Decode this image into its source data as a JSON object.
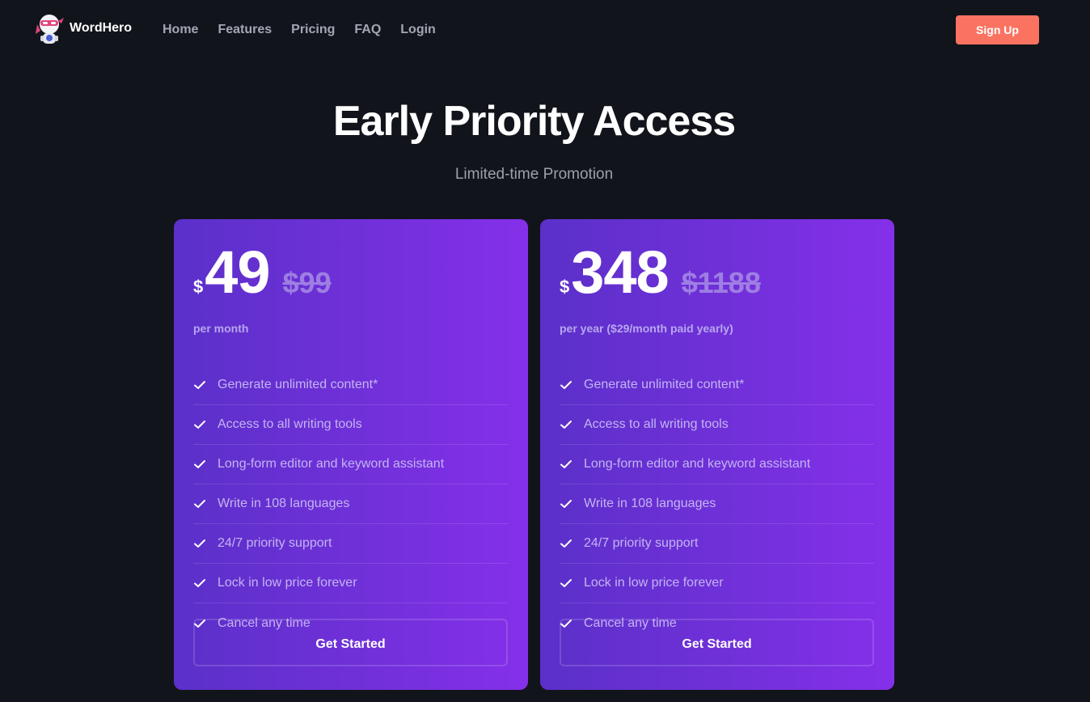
{
  "brand": {
    "name": "WordHero",
    "logo_icon": "ninja-robot-icon"
  },
  "nav": {
    "links": [
      "Home",
      "Features",
      "Pricing",
      "FAQ",
      "Login"
    ],
    "signup_label": "Sign Up"
  },
  "hero": {
    "title": "Early Priority Access",
    "subtitle": "Limited-time Promotion"
  },
  "plans": [
    {
      "currency": "$",
      "price": "49",
      "old_price": "$99",
      "period": "per month",
      "features": [
        "Generate unlimited content*",
        "Access to all writing tools",
        "Long-form editor and keyword assistant",
        "Write in 108 languages",
        "24/7 priority support",
        "Lock in low price forever",
        "Cancel any time"
      ],
      "cta": "Get Started"
    },
    {
      "currency": "$",
      "price": "348",
      "old_price": "$1188",
      "period": "per year ($29/month paid yearly)",
      "features": [
        "Generate unlimited content*",
        "Access to all writing tools",
        "Long-form editor and keyword assistant",
        "Write in 108 languages",
        "24/7 priority support",
        "Lock in low price forever",
        "Cancel any time"
      ],
      "cta": "Get Started"
    }
  ],
  "colors": {
    "background": "#12141c",
    "accent": "#fa7361",
    "card_gradient_start": "#5b30c9",
    "card_gradient_end": "#8530ea"
  }
}
